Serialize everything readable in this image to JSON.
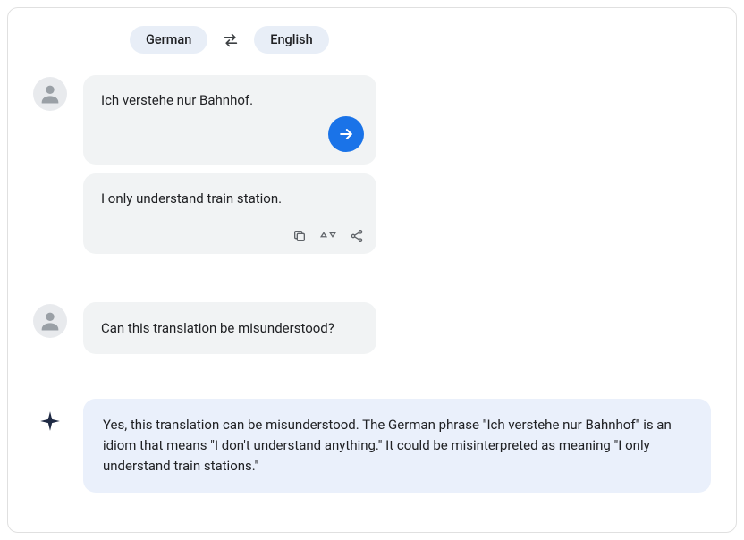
{
  "langs": {
    "source": "German",
    "target": "English"
  },
  "input_text": "Ich verstehe nur Bahnhof.",
  "translation": "I only understand train station.",
  "question": "Can this translation be misunderstood?",
  "ai_answer": "Yes, this translation can be misunderstood. The German phrase \"Ich verstehe nur Bahnhof\" is an idiom that means \"I don't understand anything.\" It could be misinterpreted as meaning \"I only understand train stations.\""
}
